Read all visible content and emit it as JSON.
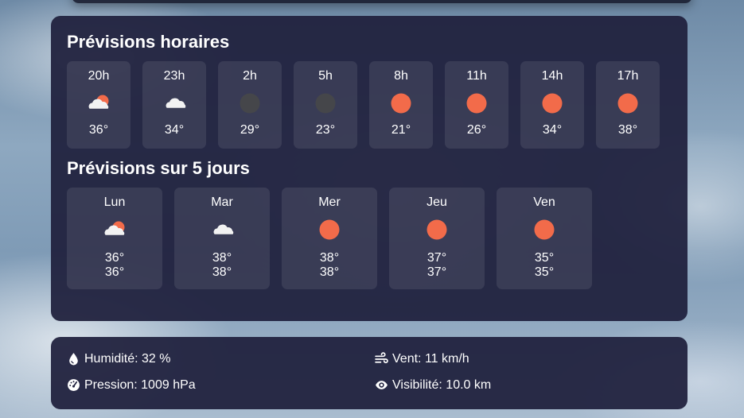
{
  "hourly": {
    "title": "Prévisions horaires",
    "items": [
      {
        "time": "20h",
        "icon": "partly-cloudy-icon",
        "temp": "36°"
      },
      {
        "time": "23h",
        "icon": "cloud-icon",
        "temp": "34°"
      },
      {
        "time": "2h",
        "icon": "moon-icon",
        "temp": "29°"
      },
      {
        "time": "5h",
        "icon": "moon-icon",
        "temp": "23°"
      },
      {
        "time": "8h",
        "icon": "sun-icon",
        "temp": "21°"
      },
      {
        "time": "11h",
        "icon": "sun-icon",
        "temp": "26°"
      },
      {
        "time": "14h",
        "icon": "sun-icon",
        "temp": "34°"
      },
      {
        "time": "17h",
        "icon": "sun-icon",
        "temp": "38°"
      }
    ]
  },
  "daily": {
    "title": "Prévisions sur 5 jours",
    "items": [
      {
        "day": "Lun",
        "icon": "partly-cloudy-icon",
        "max": "36°",
        "min": "36°"
      },
      {
        "day": "Mar",
        "icon": "cloud-icon",
        "max": "38°",
        "min": "38°"
      },
      {
        "day": "Mer",
        "icon": "sun-icon",
        "max": "38°",
        "min": "38°"
      },
      {
        "day": "Jeu",
        "icon": "sun-icon",
        "max": "37°",
        "min": "37°"
      },
      {
        "day": "Ven",
        "icon": "sun-icon",
        "max": "35°",
        "min": "35°"
      }
    ]
  },
  "stats": {
    "humidity": {
      "label": "Humidité:",
      "value": "32",
      "unit": "%",
      "icon": "droplet-icon"
    },
    "wind": {
      "label": "Vent:",
      "value": "11",
      "unit": "km/h",
      "icon": "wind-icon"
    },
    "pressure": {
      "label": "Pression:",
      "value": "1009",
      "unit": "hPa",
      "icon": "gauge-icon"
    },
    "visibility": {
      "label": "Visibilité:",
      "value": "10.0",
      "unit": "km",
      "icon": "eye-icon"
    }
  },
  "colors": {
    "sun": "#f26b4a",
    "moon": "#45464a",
    "cloud": "#f2f2f2",
    "panel": "#20213e"
  }
}
